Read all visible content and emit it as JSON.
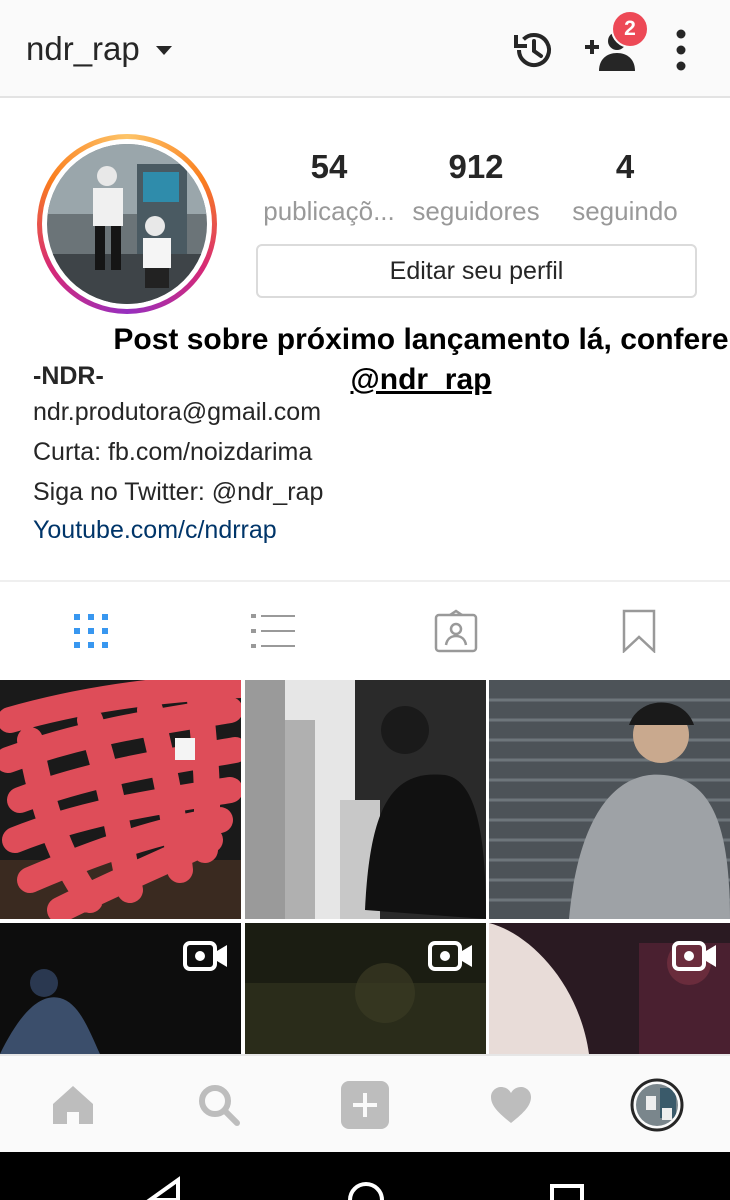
{
  "header": {
    "username": "ndr_rap",
    "badge_count": "2",
    "icons": [
      "chevron-down-icon",
      "history-icon",
      "add-user-icon",
      "more-vertical-icon"
    ]
  },
  "profile": {
    "stats": [
      {
        "value": "54",
        "label": "publicaçõ..."
      },
      {
        "value": "912",
        "label": "seguidores"
      },
      {
        "value": "4",
        "label": "seguindo"
      }
    ],
    "edit_button": "Editar seu perfil",
    "overlay_text": "Post sobre próximo lançamento lá, confere",
    "overlay_handle": "@ndr_rap",
    "bio": {
      "name": "-NDR-",
      "lines": [
        "ndr.produtora@gmail.com",
        "Curta: fb.com/noizdarima",
        "Siga no Twitter: @ndr_rap"
      ],
      "link": "Youtube.com/c/ndrrap"
    }
  },
  "tabs": [
    "grid-icon",
    "list-icon",
    "tagged-icon",
    "bookmark-icon"
  ],
  "colors": {
    "accent": "#3897f0",
    "badge": "#ed4956",
    "link": "#003569",
    "scribble": "#e9505d"
  },
  "bottom_nav": [
    "home-icon",
    "search-icon",
    "add-post-icon",
    "heart-icon",
    "profile-avatar"
  ]
}
